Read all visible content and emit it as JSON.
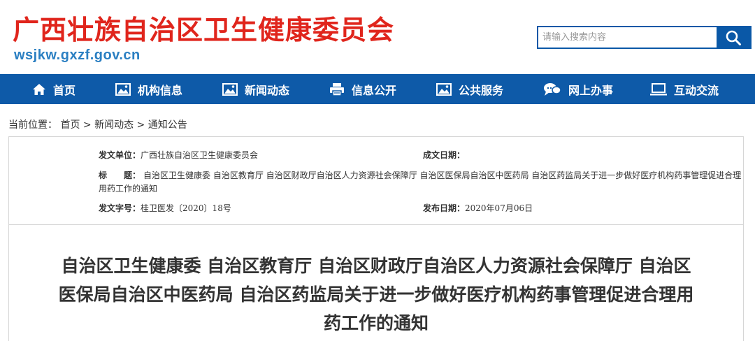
{
  "header": {
    "title": "广西壮族自治区卫生健康委员会",
    "domain": "wsjkw.gxzf.gov.cn"
  },
  "search": {
    "placeholder": "请输入搜索内容",
    "icon": "search-icon"
  },
  "nav": {
    "items": [
      {
        "label": "首页",
        "icon": "home-icon"
      },
      {
        "label": "机构信息",
        "icon": "image-icon"
      },
      {
        "label": "新闻动态",
        "icon": "image-icon"
      },
      {
        "label": "信息公开",
        "icon": "printer-icon"
      },
      {
        "label": "公共服务",
        "icon": "image-icon"
      },
      {
        "label": "网上办事",
        "icon": "chat-bubbles-icon"
      },
      {
        "label": "互动交流",
        "icon": "monitor-icon"
      }
    ]
  },
  "breadcrumb": {
    "prefix": "当前位置：",
    "items": [
      "首页",
      "新闻动态",
      "通知公告"
    ],
    "separator": " > "
  },
  "meta": {
    "issuer_label": "发文单位：",
    "issuer": "广西壮族自治区卫生健康委员会",
    "date_written_label": "成文日期：",
    "date_written": "",
    "title_label": "标　　题：",
    "title_text": "自治区卫生健康委 自治区教育厅 自治区财政厅自治区人力资源社会保障厅 自治区医保局自治区中医药局 自治区药监局关于进一步做好医疗机构药事管理促进合理用药工作的通知",
    "doc_no_label": "发文字号：",
    "doc_no": "桂卫医发〔2020〕18号",
    "publish_date_label": "发布日期：",
    "publish_date": "2020年07月06日"
  },
  "document": {
    "title_line1": "自治区卫生健康委 自治区教育厅 自治区财政厅自治区人力资源社会保障厅 自治区",
    "title_line2": "医保局自治区中医药局 自治区药监局关于进一步做好医疗机构药事管理促进合理用",
    "title_line3": "药工作的通知"
  },
  "colors": {
    "brand_red": "#e0251c",
    "nav_blue": "#0e5aa8",
    "domain_blue": "#2a7fc2"
  }
}
